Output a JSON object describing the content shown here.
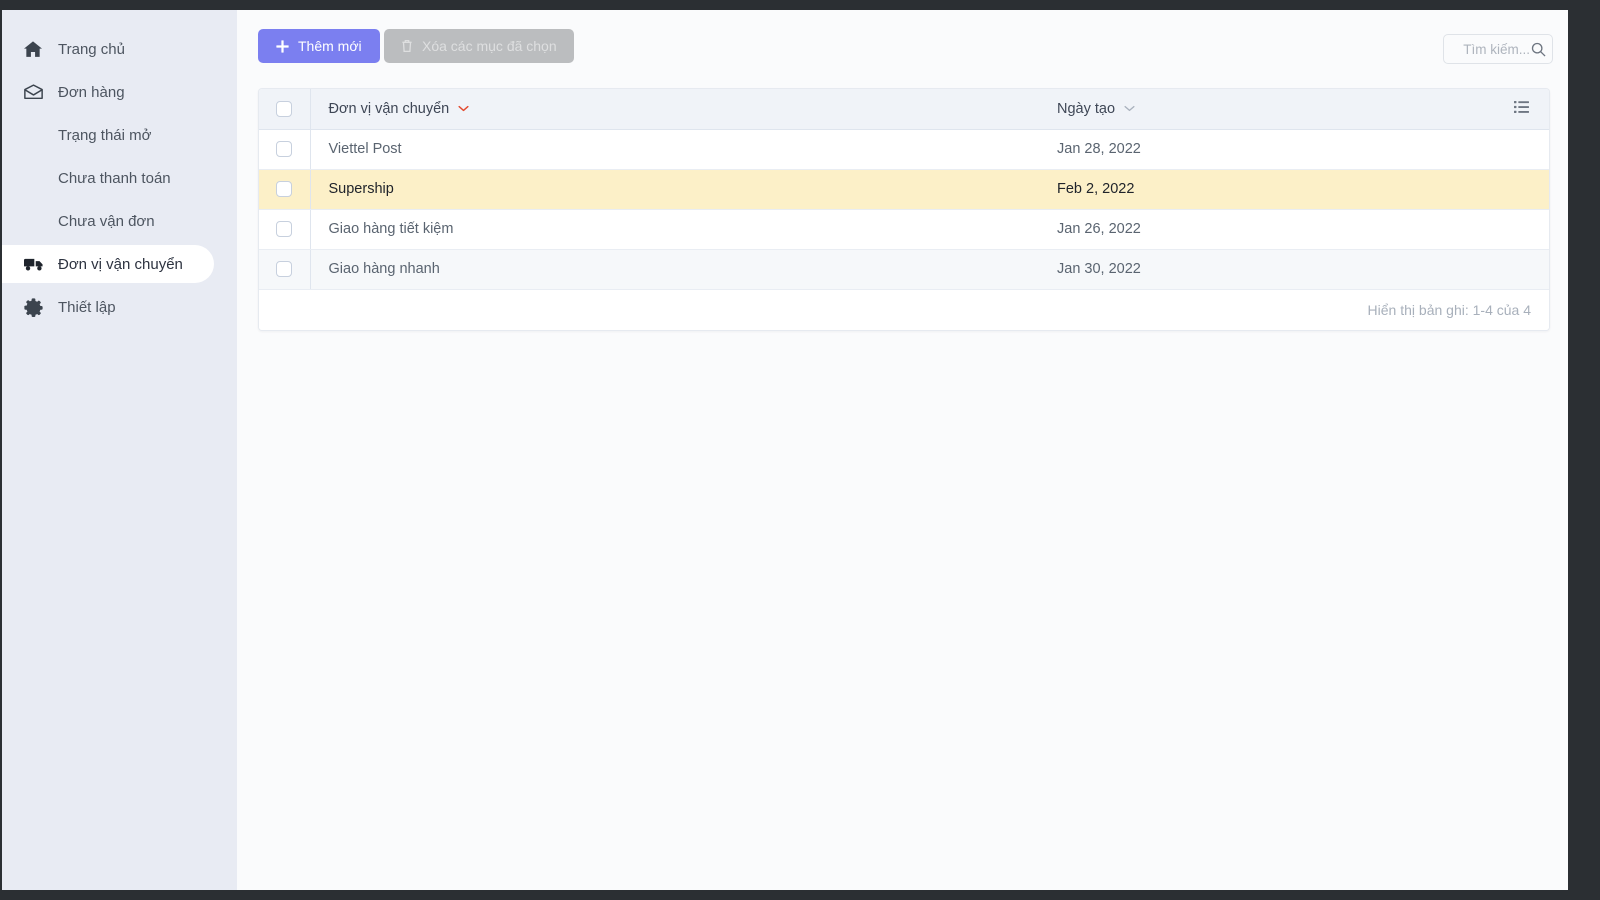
{
  "sidebar": {
    "items": [
      {
        "label": "Trang chủ",
        "icon": "home-icon",
        "level": "top",
        "active": false
      },
      {
        "label": "Đơn hàng",
        "icon": "mail-icon",
        "level": "top",
        "active": false
      },
      {
        "label": "Trạng thái mở",
        "icon": "",
        "level": "sub",
        "active": false
      },
      {
        "label": "Chưa thanh toán",
        "icon": "",
        "level": "sub",
        "active": false
      },
      {
        "label": "Chưa vận đơn",
        "icon": "",
        "level": "sub",
        "active": false
      },
      {
        "label": "Đơn vị vận chuyển",
        "icon": "truck-icon",
        "level": "top",
        "active": true
      },
      {
        "label": "Thiết lập",
        "icon": "gear-icon",
        "level": "top",
        "active": false
      }
    ],
    "active_accent": "#5b6cf0"
  },
  "toolbar": {
    "add_label": "Thêm mới",
    "add_icon": "plus-icon",
    "add_color": "#7b7ff0",
    "delete_label": "Xóa các mục đã chọn",
    "delete_icon": "trash-icon",
    "delete_color": "#bbbdbf",
    "delete_disabled": true
  },
  "search": {
    "placeholder": "Tìm kiếm...",
    "value": "",
    "icon": "search-icon"
  },
  "table": {
    "columns": [
      {
        "key": "select",
        "label": "",
        "sort_icon": "",
        "sort_state": "none"
      },
      {
        "key": "name",
        "label": "Đơn vị vận chuyển",
        "sort_icon": "chevron-down-icon",
        "sort_state": "active"
      },
      {
        "key": "date",
        "label": "Ngày tạo",
        "sort_icon": "chevron-down-icon",
        "sort_state": "idle"
      },
      {
        "key": "menu",
        "label": "",
        "sort_icon": "list-icon",
        "sort_state": "none"
      }
    ],
    "header_sort_active_color": "#e34a2f",
    "header_select_all_checked": false,
    "rows": [
      {
        "name": "Viettel Post",
        "date": "Jan 28, 2022",
        "checked": false,
        "state": "default"
      },
      {
        "name": "Supership",
        "date": "Feb 2, 2022",
        "checked": false,
        "state": "marked"
      },
      {
        "name": "Giao hàng tiết kiệm",
        "date": "Jan 26, 2022",
        "checked": false,
        "state": "default"
      },
      {
        "name": "Giao hàng nhanh",
        "date": "Jan 30, 2022",
        "checked": false,
        "state": "hover"
      }
    ],
    "footer_text": "Hiển thị bản ghi: 1-4 của 4",
    "marked_row_color": "#fcf0c8"
  }
}
